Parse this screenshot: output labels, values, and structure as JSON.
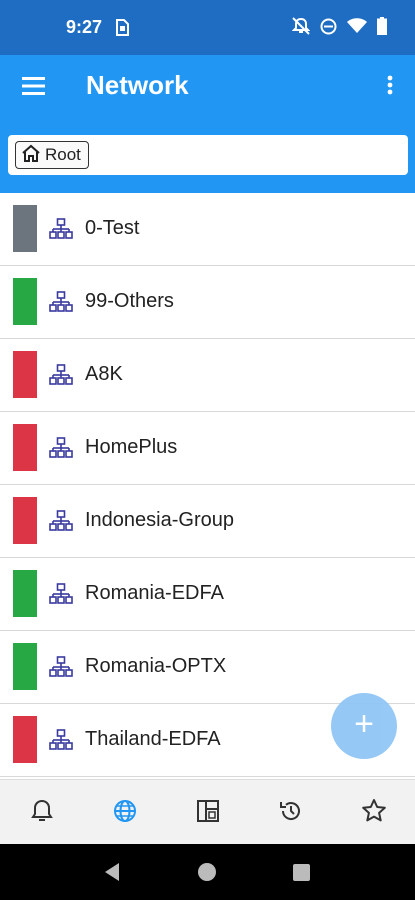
{
  "status": {
    "time": "9:27"
  },
  "appbar": {
    "title": "Network"
  },
  "breadcrumb": {
    "root_label": "Root"
  },
  "colors": {
    "gray": "#6c757d",
    "green": "#28a745",
    "red": "#dc3545",
    "primary": "#2196f3"
  },
  "items": [
    {
      "label": "0-Test",
      "status": "gray"
    },
    {
      "label": "99-Others",
      "status": "green"
    },
    {
      "label": "A8K",
      "status": "red"
    },
    {
      "label": "HomePlus",
      "status": "red"
    },
    {
      "label": "Indonesia-Group",
      "status": "red"
    },
    {
      "label": "Romania-EDFA",
      "status": "green"
    },
    {
      "label": "Romania-OPTX",
      "status": "green"
    },
    {
      "label": "Thailand-EDFA",
      "status": "red"
    }
  ],
  "fab": {
    "label": "+"
  },
  "bottom_nav": [
    "bell-icon",
    "globe-icon",
    "dashboard-icon",
    "history-icon",
    "star-icon"
  ]
}
